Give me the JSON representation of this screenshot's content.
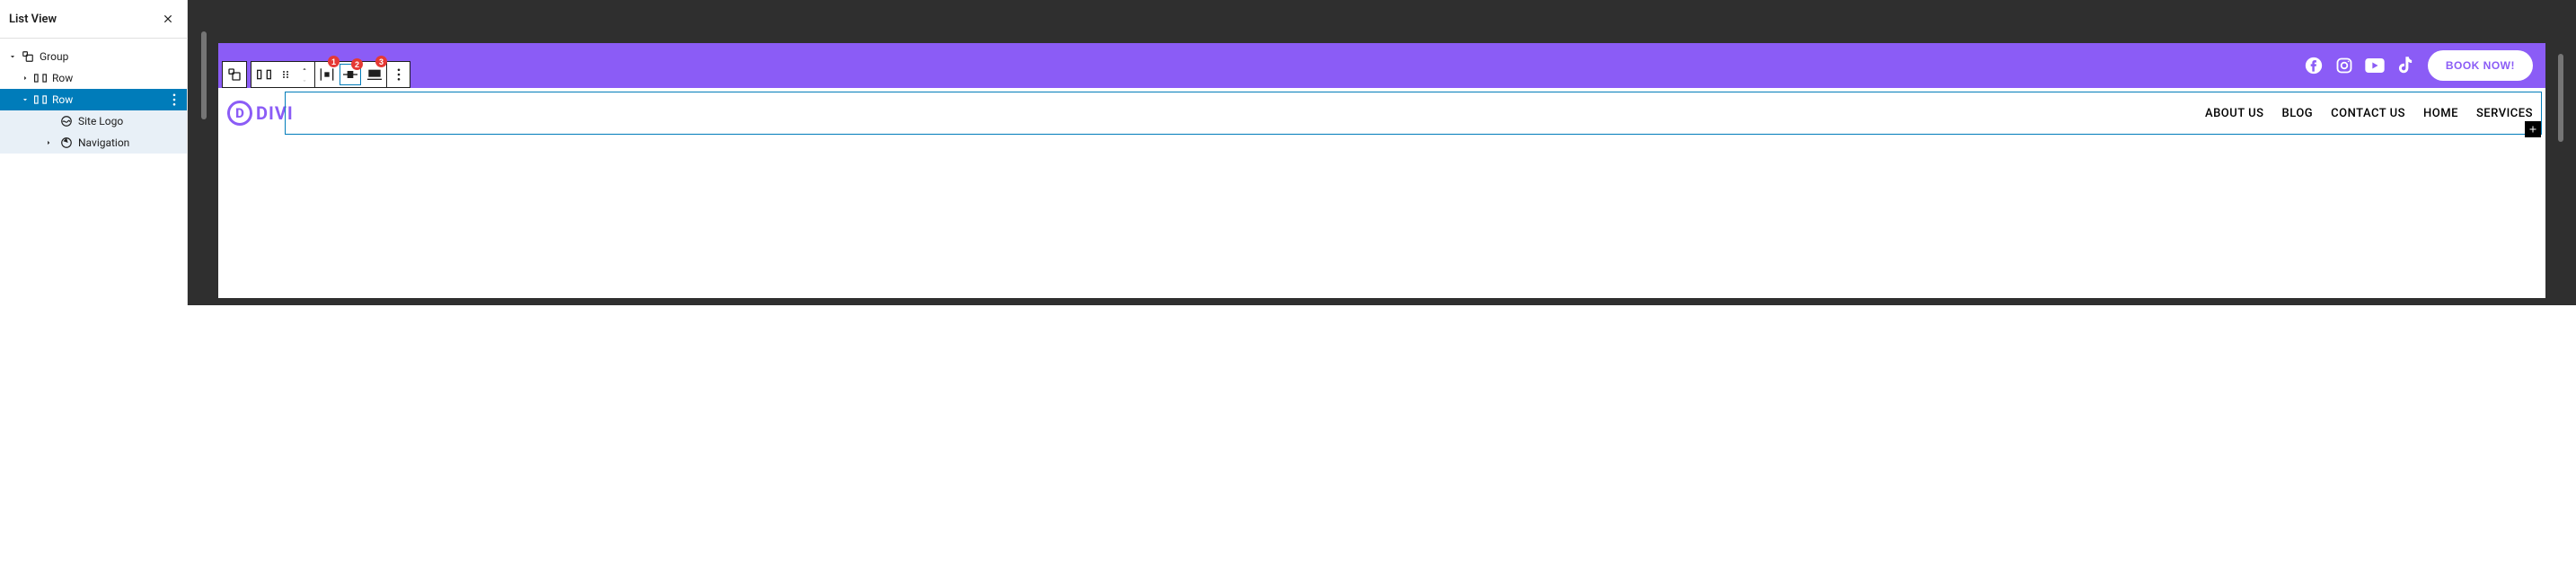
{
  "sidebar": {
    "title": "List View",
    "close_icon": "close",
    "tree": {
      "group": {
        "label": "Group",
        "icon": "group"
      },
      "row1": {
        "label": "Row",
        "icon": "row"
      },
      "row2": {
        "label": "Row",
        "icon": "row"
      },
      "site_logo": {
        "label": "Site Logo",
        "icon": "sitelogo"
      },
      "navigation": {
        "label": "Navigation",
        "icon": "nav"
      }
    }
  },
  "toolbar": {
    "badges": {
      "b1": "1",
      "b2": "2",
      "b3": "3"
    }
  },
  "header": {
    "book_label": "BOOK NOW!",
    "logo_letter": "D",
    "logo_text": "DIVI",
    "nav": {
      "about": "ABOUT US",
      "blog": "BLOG",
      "contact": "CONTACT US",
      "home": "HOME",
      "services": "SERVICES"
    }
  }
}
